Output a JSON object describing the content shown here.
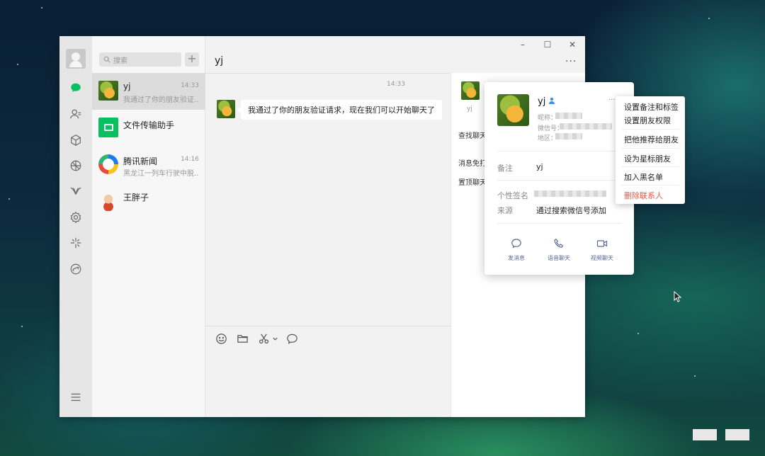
{
  "colors": {
    "accent": "#07c160",
    "danger": "#e8584c",
    "link": "#576b95"
  },
  "window": {
    "controls": {
      "minimize": "–",
      "maximize": "☐",
      "close": "✕"
    }
  },
  "nav": {
    "items": [
      "chat-icon",
      "contacts-icon",
      "box-icon",
      "moments-icon",
      "channels-icon",
      "gear-icon",
      "sparkle-icon",
      "miniprogram-icon",
      "menu-icon"
    ]
  },
  "chatlist": {
    "search_placeholder": "搜索",
    "add_label": "+",
    "items": [
      {
        "name": "yj",
        "time": "14:33",
        "preview": "我通过了你的朋友验证...",
        "avatar": "duck-avatar"
      },
      {
        "name": "文件传输助手",
        "time": "",
        "preview": "",
        "avatar": "file-transfer-icon"
      },
      {
        "name": "腾讯新闻",
        "time": "14:16",
        "preview": "黑龙江一列车行驶中脱...",
        "avatar": "tencent-news-icon"
      },
      {
        "name": "王胖子",
        "time": "",
        "preview": "",
        "avatar": "cartoon-avatar"
      }
    ]
  },
  "chat": {
    "title": "yj",
    "more": "···",
    "message_time": "14:33",
    "message_text": "我通过了你的朋友验证请求，现在我们可以开始聊天了"
  },
  "side_panel": {
    "name": "yj",
    "rows": [
      "查找聊天",
      "消息免打",
      "置顶聊天"
    ]
  },
  "profile_card": {
    "name": "yj",
    "dots": "···",
    "nickname_label": "昵称：",
    "wechat_id_label": "微信号：",
    "region_label": "地区：",
    "remark_label": "备注",
    "remark_value": "yj",
    "signature_label": "个性签名",
    "source_label": "来源",
    "source_value": "通过搜索微信号添加",
    "actions": {
      "message": "发消息",
      "voice": "语音聊天",
      "video": "视频聊天"
    }
  },
  "context_menu": {
    "items": [
      "设置备注和标签",
      "设置朋友权限",
      "把他推荐给朋友",
      "设为星标朋友",
      "加入黑名单"
    ],
    "danger_item": "删除联系人"
  }
}
